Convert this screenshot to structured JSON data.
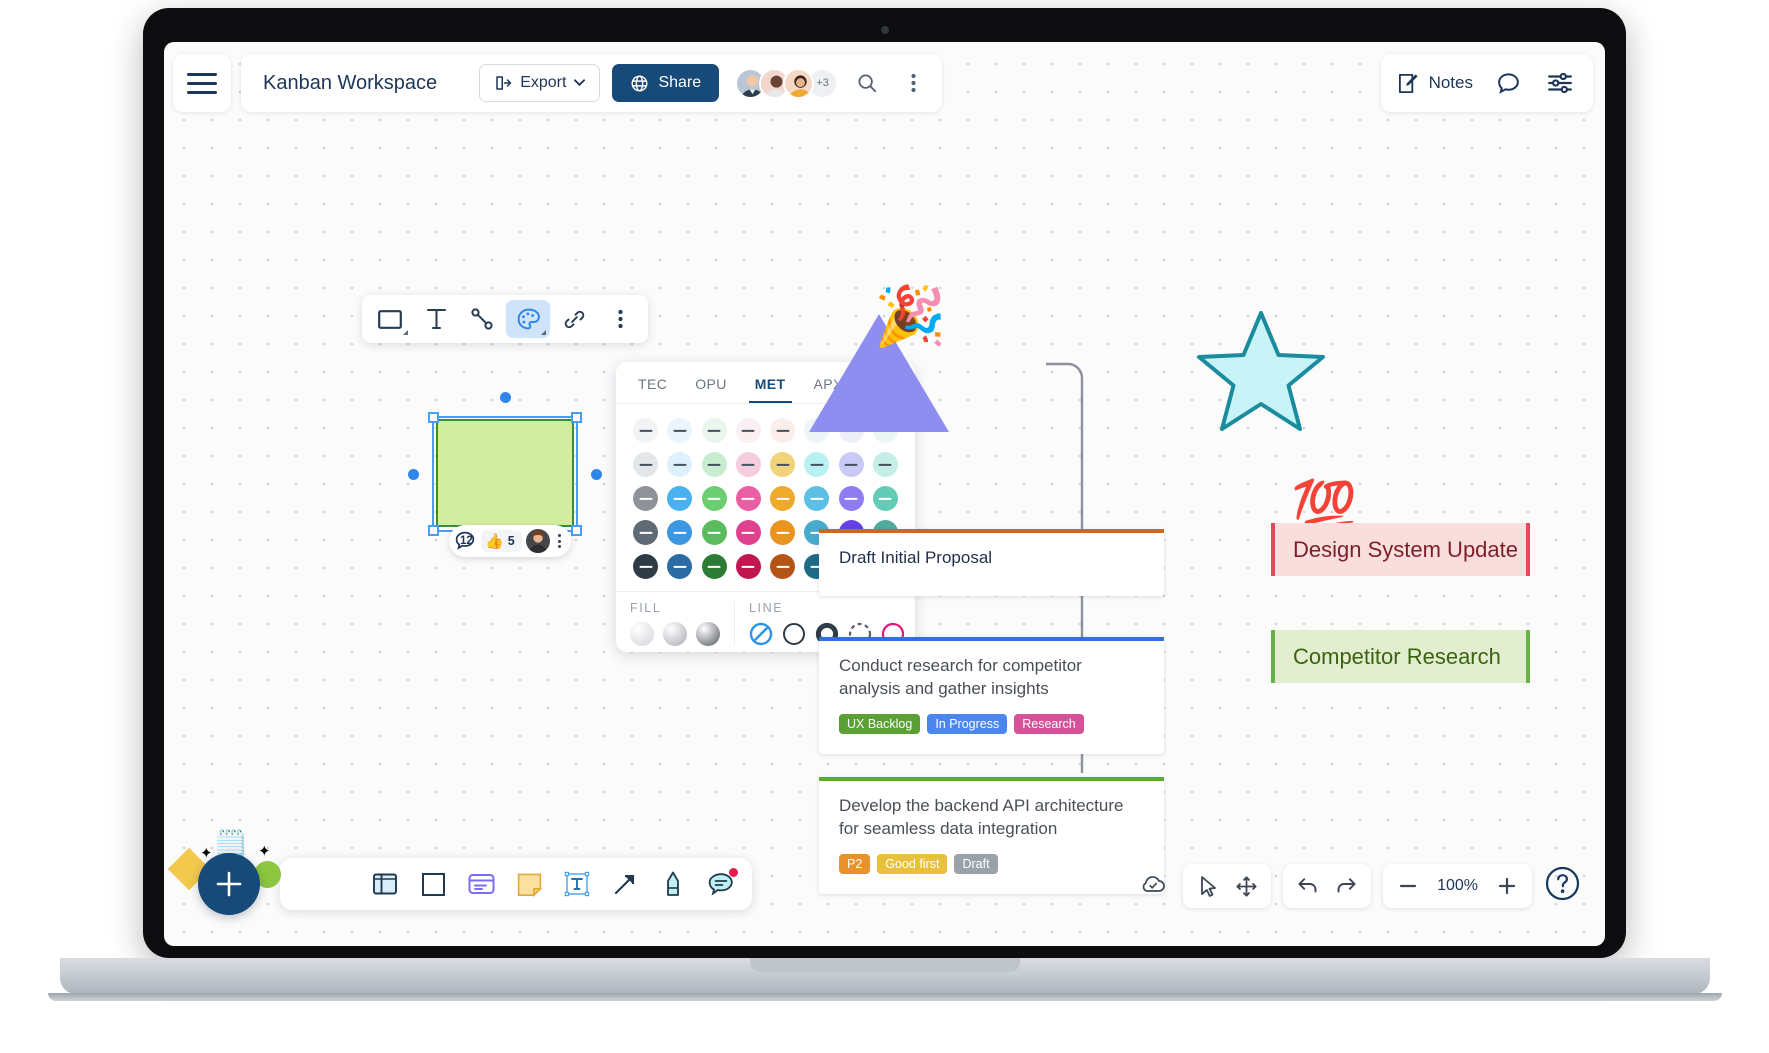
{
  "app": {
    "board_title": "Kanban Workspace",
    "brand_color": "#174a78"
  },
  "header": {
    "menu_icon": "hamburger-menu-icon",
    "export_label": "Export",
    "export_icon": "export-icon",
    "share_label": "Share",
    "share_icon": "globe-icon",
    "avatar_overflow": "+3",
    "search_icon": "search-icon",
    "more_icon": "more-vertical-icon",
    "notes_label": "Notes",
    "notes_icon": "edit-note-icon",
    "comment_icon": "comment-bubble-icon",
    "settings_icon": "sliders-icon"
  },
  "shape_toolbar": {
    "items": [
      {
        "name": "shape-tool",
        "icon": "rectangle-icon"
      },
      {
        "name": "text-tool",
        "icon": "text-t-icon"
      },
      {
        "name": "line-tool",
        "icon": "line-connector-icon"
      },
      {
        "name": "color-tool",
        "icon": "palette-icon"
      },
      {
        "name": "link-tool",
        "icon": "link-chain-icon"
      },
      {
        "name": "more-tool",
        "icon": "more-vertical-icon"
      }
    ],
    "active_index": 3
  },
  "color_panel": {
    "tabs": [
      "TEC",
      "OPU",
      "MET",
      "APX"
    ],
    "active_tab": "MET",
    "swatches": [
      [
        "#f2f3f5",
        "#eaf4fb",
        "#eaf5ee",
        "#fbeff1",
        "#fbeeea",
        "#edf5f8",
        "#eeeefb",
        "#eaf6f4"
      ],
      [
        "#e4e7ea",
        "#ddf0fb",
        "#c8eccf",
        "#f6ccdf",
        "#f3d37a",
        "#b9f0f2",
        "#c9c9f5",
        "#c4eee6"
      ],
      [
        "#8f9399",
        "#49b2ee",
        "#6cce72",
        "#ea5fa4",
        "#eeaa2a",
        "#5bc0e4",
        "#8f7cf0",
        "#62ccb7"
      ],
      [
        "#606a75",
        "#3d96e0",
        "#5cbb5f",
        "#e0418e",
        "#e99421",
        "#49abcb",
        "#6741e6",
        "#52ab9c"
      ],
      [
        "#2f3b46",
        "#2a6ba6",
        "#2e7b35",
        "#c2164f",
        "#b45518",
        "#1f6b85",
        "#2816cb",
        "#1f6355"
      ]
    ],
    "fill_label": "FILL",
    "line_label": "LINE",
    "fill_options": [
      "#d8dade",
      "#b3b6bb",
      "#6c7077"
    ],
    "line_options": [
      {
        "name": "line-none-option",
        "color": "#2d93e8"
      },
      {
        "name": "line-thin-option",
        "color": "#2f3b46"
      },
      {
        "name": "line-thick-option",
        "color": "#2f3b46"
      },
      {
        "name": "line-dashed-option",
        "color": "#5a6472"
      },
      {
        "name": "line-accent-option",
        "color": "#e3187e"
      }
    ]
  },
  "selected_shape": {
    "fill": "#d3eda0",
    "stroke": "#3e8b38",
    "comment_count": "12",
    "reaction_emoji": "thumbs-up-icon",
    "reaction_count": "5"
  },
  "board": {
    "shapes": [
      {
        "name": "triangle-shape",
        "color": "#8d8ef0"
      },
      {
        "name": "star-shape",
        "fill": "#c9f4f7",
        "stroke": "#1a8c9e"
      },
      {
        "name": "party-popper-sticker",
        "glyph": "🎉"
      },
      {
        "name": "hundred-points-sticker",
        "glyph": "💯"
      }
    ],
    "task_cards": [
      {
        "title": "Draft Initial Proposal",
        "accent": "#d2651f",
        "tags": []
      },
      {
        "title": "Conduct research for competitor analysis and gather insights",
        "accent": "#2f72d8",
        "tags": [
          {
            "label": "UX Backlog",
            "color": "#5ba035"
          },
          {
            "label": "In Progress",
            "color": "#4a86ee"
          },
          {
            "label": "Research",
            "color": "#d6519a"
          }
        ]
      },
      {
        "title": "Develop the backend API architecture for seamless data integration",
        "accent": "#5aac2b",
        "tags": [
          {
            "label": "P2",
            "color": "#e8912d"
          },
          {
            "label": "Good first",
            "color": "#e8c13c"
          },
          {
            "label": "Draft",
            "color": "#9aa1a9"
          }
        ]
      }
    ],
    "note_cards": [
      {
        "title": "Design System Update",
        "bg": "#fadedd",
        "bar": "#e8485f",
        "text_color": "#7d1f28"
      },
      {
        "title": "Competitor Research",
        "bg": "#e2eecf",
        "bar": "#6ab04a",
        "text_color": "#3a6410"
      }
    ]
  },
  "bottom_toolbar": {
    "add_label": "+",
    "items": [
      {
        "name": "frame-tool",
        "icon": "frame-board-icon"
      },
      {
        "name": "rectangle-tool",
        "icon": "square-outline-icon"
      },
      {
        "name": "card-tool",
        "icon": "card-icon"
      },
      {
        "name": "sticky-note-tool",
        "icon": "sticky-note-icon"
      },
      {
        "name": "text-tool",
        "icon": "text-box-icon"
      },
      {
        "name": "arrow-tool",
        "icon": "arrow-up-right-icon"
      },
      {
        "name": "highlighter-tool",
        "icon": "highlighter-pen-icon"
      },
      {
        "name": "comment-tool",
        "icon": "comment-bubble-icon",
        "badge": true
      }
    ]
  },
  "bottom_right": {
    "save_icon": "cloud-check-icon",
    "select_icon": "cursor-arrow-icon",
    "pan_icon": "move-hand-icon",
    "undo_icon": "undo-arrow-icon",
    "redo_icon": "redo-arrow-icon",
    "zoom_out_icon": "minus-icon",
    "zoom_level": "100%",
    "zoom_in_icon": "plus-icon",
    "help_icon": "question-mark-icon"
  }
}
